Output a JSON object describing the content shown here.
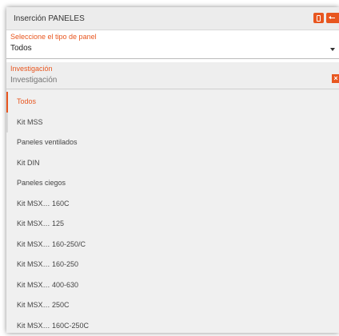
{
  "window": {
    "title": "Inserción PANELES",
    "accent_color": "#e8561f",
    "buttons": [
      {
        "name": "pin",
        "icon": "pin-icon"
      },
      {
        "name": "collapse",
        "icon": "collapse-left-icon"
      }
    ]
  },
  "panel_type": {
    "label": "Seleccione el tipo de panel",
    "value": "Todos",
    "icon": "chevron-down-icon"
  },
  "search": {
    "label": "Investigación",
    "placeholder": "Investigación",
    "clear_icon": "close-icon",
    "clear_label": "×"
  },
  "options": [
    "Todos",
    "Kit MSS",
    "Paneles ventilados",
    "Kit DIN",
    "Paneles ciegos",
    "Kit MSX… 160C",
    "Kit MSX… 125",
    "Kit MSX… 160-250/C",
    "Kit MSX… 160-250",
    "Kit MSX… 400-630",
    "Kit MSX… 250C",
    "Kit MSX… 160C-250C"
  ],
  "selected_option": "Todos"
}
